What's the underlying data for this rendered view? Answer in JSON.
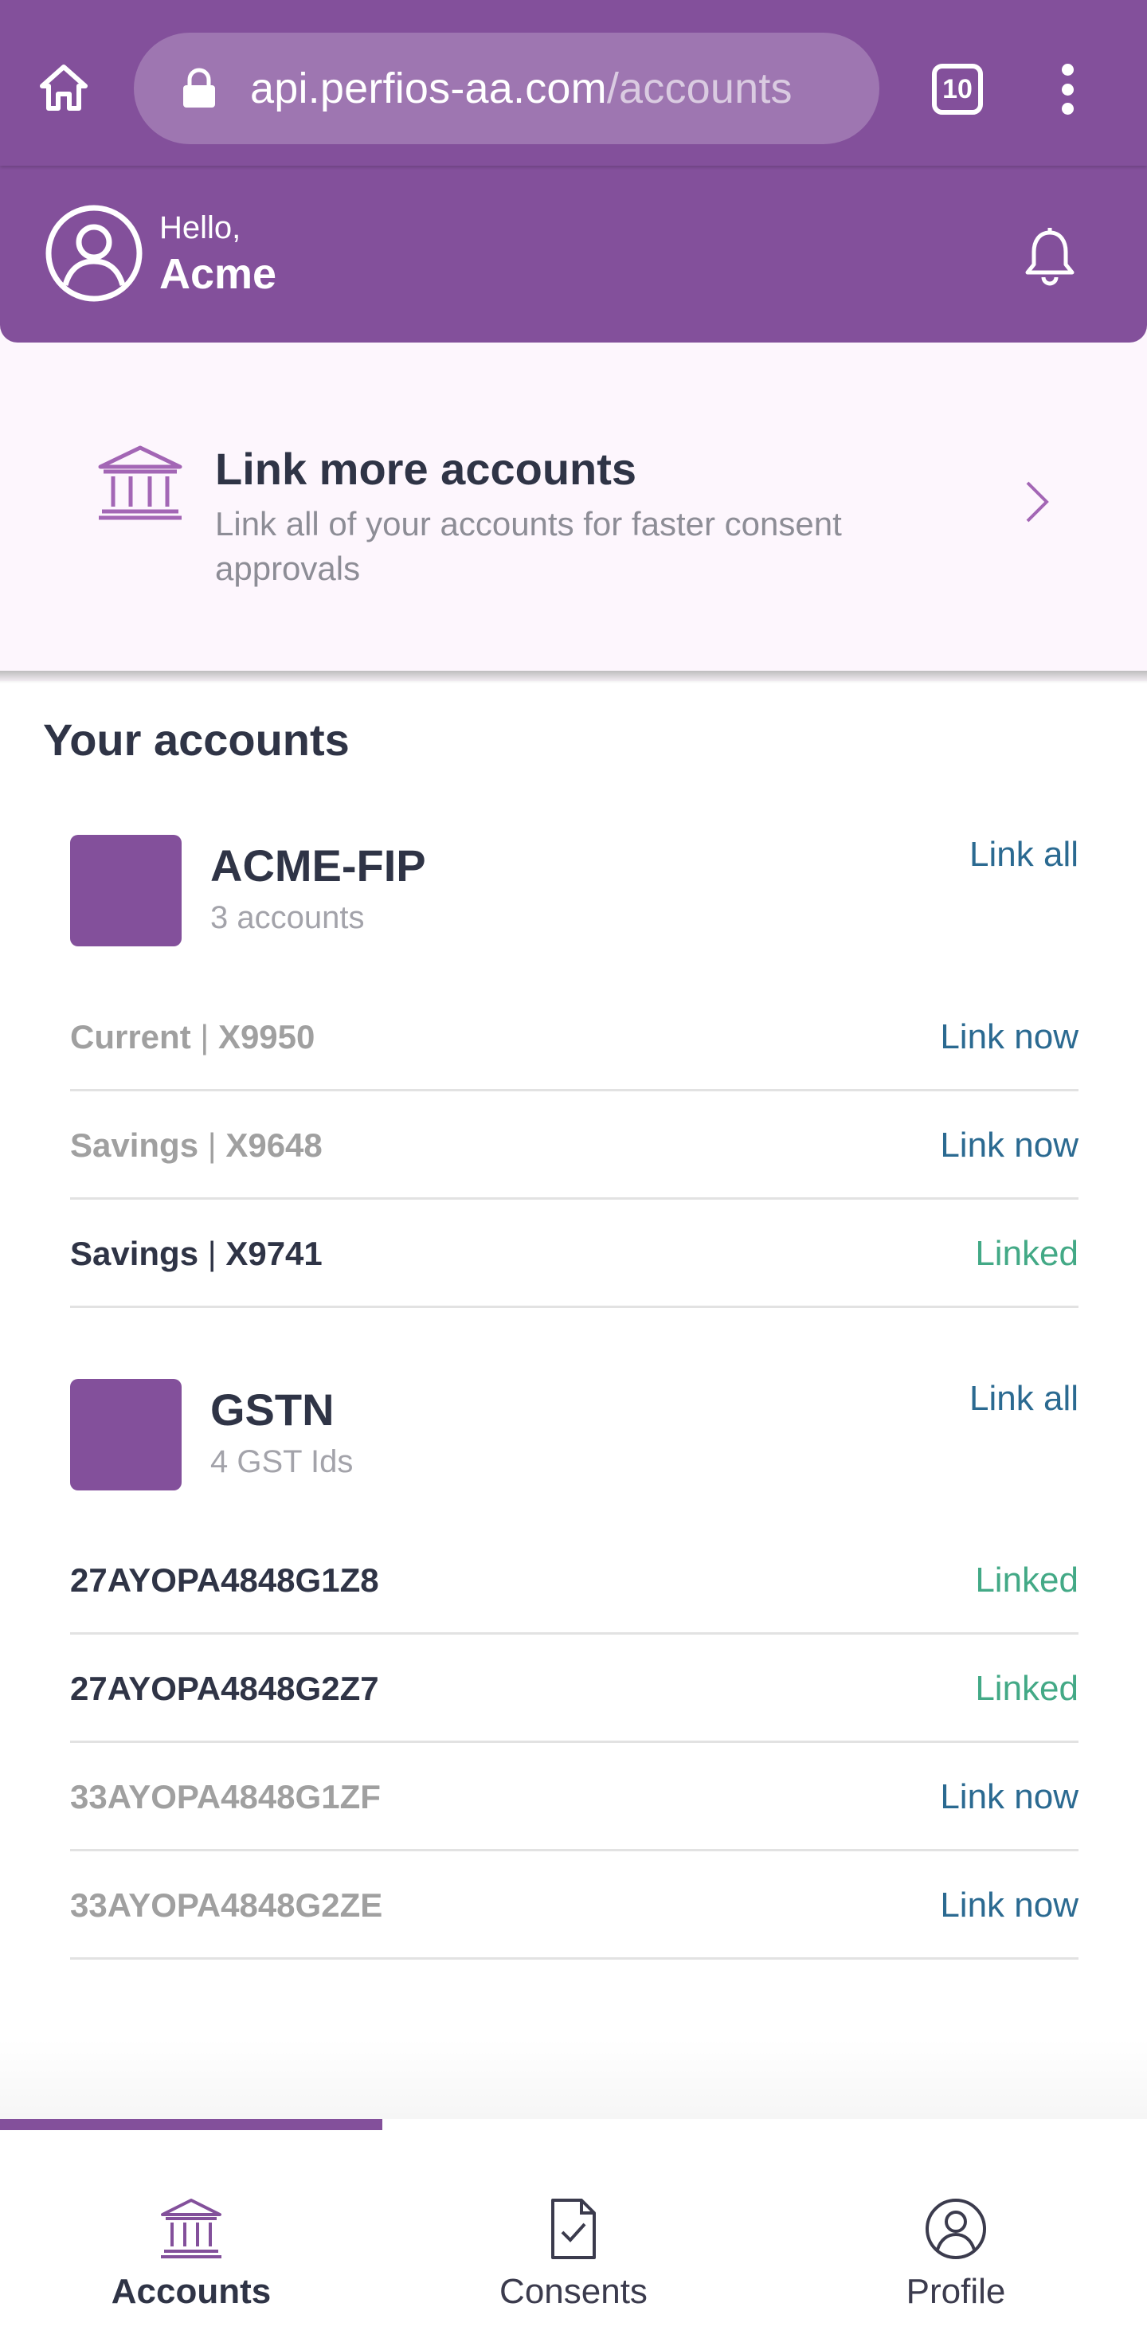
{
  "browser": {
    "url_domain": "api.perfios-aa.com",
    "url_path": "/accounts",
    "tab_count": "10",
    "icons": [
      "home-icon",
      "lock-icon",
      "tabs-icon",
      "more-vert-icon"
    ]
  },
  "header": {
    "hello": "Hello,",
    "user_name": "Acme",
    "icons": [
      "avatar-icon",
      "bell-icon"
    ]
  },
  "link_more": {
    "title": "Link more accounts",
    "subtitle": "Link all of your accounts for faster consent approvals"
  },
  "accounts": {
    "title": "Your accounts",
    "fips": [
      {
        "name": "ACME-FIP",
        "count": "3 accounts",
        "link_all": "Link all",
        "rows": [
          {
            "type": "Current",
            "sep": " | ",
            "id": "X9950",
            "action": "Link now",
            "linked": false
          },
          {
            "type": "Savings",
            "sep": " | ",
            "id": "X9648",
            "action": "Link now",
            "linked": false
          },
          {
            "type": "Savings",
            "sep": " | ",
            "id": "X9741",
            "action": "Linked",
            "linked": true
          }
        ]
      },
      {
        "name": "GSTN",
        "count": "4 GST Ids",
        "link_all": "Link all",
        "rows": [
          {
            "id": "27AYOPA4848G1Z8",
            "action": "Linked",
            "linked": true
          },
          {
            "id": "27AYOPA4848G2Z7",
            "action": "Linked",
            "linked": true
          },
          {
            "id": "33AYOPA4848G1ZF",
            "action": "Link now",
            "linked": false
          },
          {
            "id": "33AYOPA4848G2ZE",
            "action": "Link now",
            "linked": false
          }
        ]
      }
    ]
  },
  "bottom_nav": {
    "items": [
      {
        "label": "Accounts",
        "icon": "bank-icon",
        "active": true
      },
      {
        "label": "Consents",
        "icon": "document-check-icon",
        "active": false
      },
      {
        "label": "Profile",
        "icon": "user-circle-icon",
        "active": false
      }
    ]
  },
  "colors": {
    "brand": "#83509b",
    "link_blue": "#2b6a91",
    "linked_green": "#43a986",
    "banner_bg": "#fdf6fd"
  }
}
